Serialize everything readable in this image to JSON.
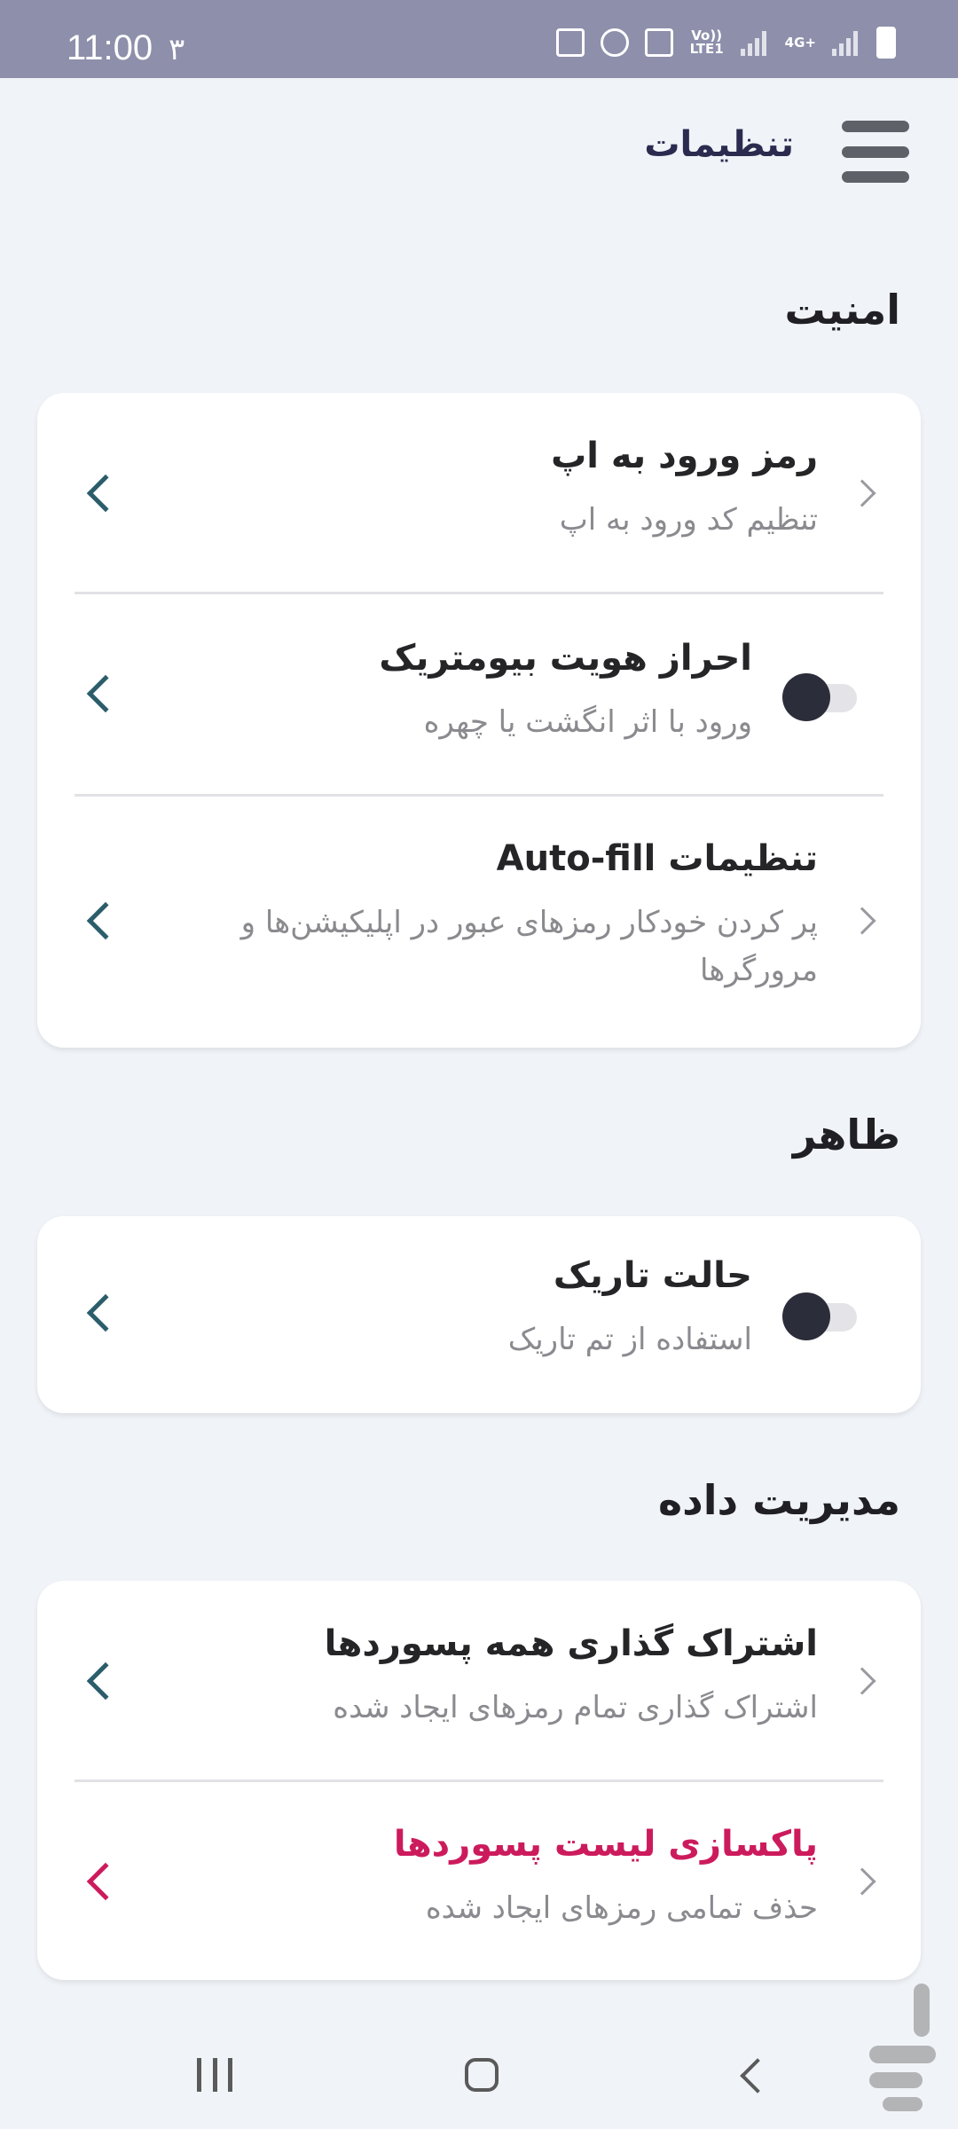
{
  "status_bar": {
    "time": "11:00",
    "extra": "۳",
    "network_label_1": "Vo)) LTE1",
    "network_label_2": "4G+"
  },
  "header": {
    "title": "تنظیمات",
    "menu_icon": "hamburger-menu-icon"
  },
  "sections": {
    "security": {
      "title": "امنیت",
      "items": [
        {
          "title": "رمز ورود به اپ",
          "subtitle": "تنظیم کد ورود به اپ"
        },
        {
          "title": "احراز هویت بیومتریک",
          "subtitle": "ورود با اثر انگشت یا چهره",
          "toggle_on": false
        },
        {
          "title": "تنظیمات Auto-fill",
          "subtitle": "پر کردن خودکار رمزهای عبور در اپلیکیشن‌ها و مرورگرها"
        }
      ]
    },
    "appearance": {
      "title": "ظاهر",
      "items": [
        {
          "title": "حالت تاریک",
          "subtitle": "استفاده از تم تاریک",
          "toggle_on": false
        }
      ]
    },
    "data": {
      "title": "مدیریت داده",
      "items": [
        {
          "title": "اشتراک گذاری همه پسوردها",
          "subtitle": "اشتراک گذاری تمام رمزهای ایجاد شده"
        },
        {
          "title": "پاکسازی لیست پسوردها",
          "subtitle": "حذف تمامی رمزهای ایجاد شده"
        }
      ]
    }
  },
  "colors": {
    "accent": "#2b5d6a",
    "danger": "#cc1b5c",
    "status_bar": "#8d8fab",
    "background": "#f0f3f7"
  }
}
